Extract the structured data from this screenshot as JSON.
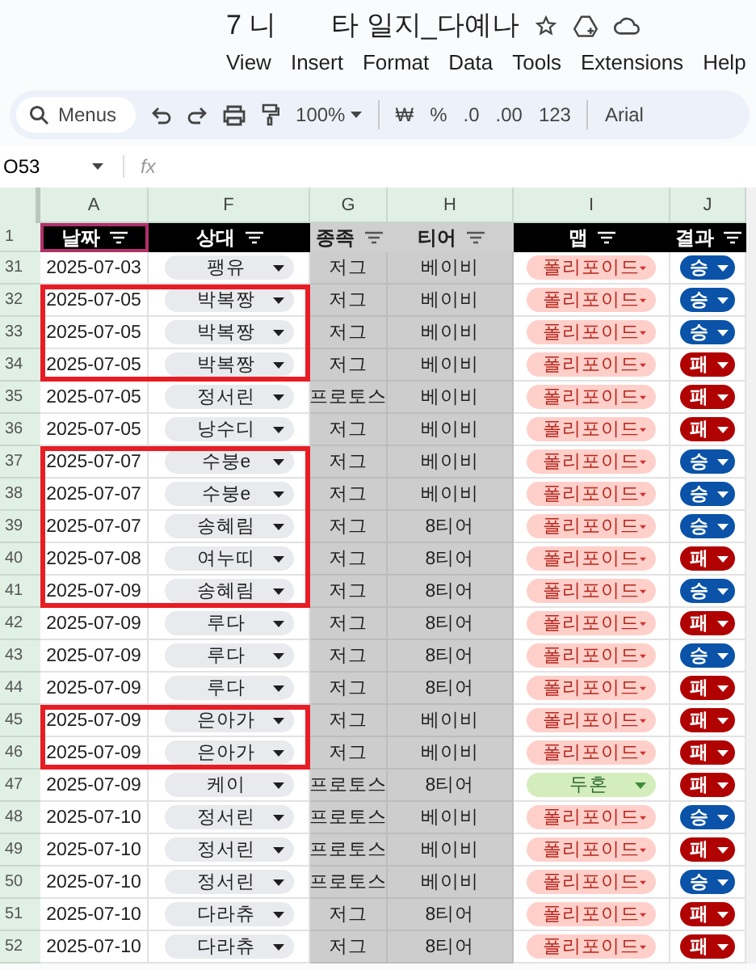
{
  "window": {
    "title_start": "7 니",
    "title_end": "타 일지_다예나"
  },
  "menu": [
    "View",
    "Insert",
    "Format",
    "Data",
    "Tools",
    "Extensions",
    "Help"
  ],
  "toolbar": {
    "search_label": "Menus",
    "zoom": "100%",
    "currency": "₩",
    "percent": "%",
    "decrease_decimal": ".0",
    "increase_decimal": ".00",
    "number_format": "123",
    "font": "Arial"
  },
  "name_box": "O53",
  "formula_label": "fx",
  "sheet": {
    "columns": [
      "A",
      "F",
      "G",
      "H",
      "I",
      "J"
    ],
    "header_row": "1",
    "headers": [
      {
        "label": "날짜",
        "kind": "dark",
        "selected": true
      },
      {
        "label": "상대",
        "kind": "dark",
        "selected": false
      },
      {
        "label": "종족",
        "kind": "shaded",
        "selected": false
      },
      {
        "label": "티어",
        "kind": "shaded",
        "selected": false
      },
      {
        "label": "맵",
        "kind": "dark",
        "selected": false
      },
      {
        "label": "결과",
        "kind": "dark",
        "selected": false
      }
    ],
    "row_groups": [
      {
        "outlined": false,
        "rows": [
          {
            "number": "31",
            "date": "2025-07-03",
            "opponent": "팽유",
            "race": "저그",
            "tier": "베이비",
            "map": {
              "label": "폴리포이드",
              "color": "#ffcfc9"
            },
            "result": {
              "label": "승",
              "color": "#0a53a8"
            }
          }
        ]
      },
      {
        "outlined": true,
        "rows": [
          {
            "number": "32",
            "date": "2025-07-05",
            "opponent": "박복짱",
            "race": "저그",
            "tier": "베이비",
            "map": {
              "label": "폴리포이드",
              "color": "#ffcfc9"
            },
            "result": {
              "label": "승",
              "color": "#0a53a8"
            }
          },
          {
            "number": "33",
            "date": "2025-07-05",
            "opponent": "박복짱",
            "race": "저그",
            "tier": "베이비",
            "map": {
              "label": "폴리포이드",
              "color": "#ffcfc9"
            },
            "result": {
              "label": "승",
              "color": "#0a53a8"
            }
          },
          {
            "number": "34",
            "date": "2025-07-05",
            "opponent": "박복짱",
            "race": "저그",
            "tier": "베이비",
            "map": {
              "label": "폴리포이드",
              "color": "#ffcfc9"
            },
            "result": {
              "label": "패",
              "color": "#b10202"
            }
          }
        ]
      },
      {
        "outlined": false,
        "rows": [
          {
            "number": "35",
            "date": "2025-07-05",
            "opponent": "정서린",
            "race": "프로토스",
            "tier": "베이비",
            "map": {
              "label": "폴리포이드",
              "color": "#ffcfc9"
            },
            "result": {
              "label": "패",
              "color": "#b10202"
            }
          },
          {
            "number": "36",
            "date": "2025-07-05",
            "opponent": "낭수디",
            "race": "저그",
            "tier": "베이비",
            "map": {
              "label": "폴리포이드",
              "color": "#ffcfc9"
            },
            "result": {
              "label": "패",
              "color": "#b10202"
            }
          }
        ]
      },
      {
        "outlined": true,
        "rows": [
          {
            "number": "37",
            "date": "2025-07-07",
            "opponent": "수붕e",
            "race": "저그",
            "tier": "베이비",
            "map": {
              "label": "폴리포이드",
              "color": "#ffcfc9"
            },
            "result": {
              "label": "승",
              "color": "#0a53a8"
            }
          },
          {
            "number": "38",
            "date": "2025-07-07",
            "opponent": "수붕e",
            "race": "저그",
            "tier": "베이비",
            "map": {
              "label": "폴리포이드",
              "color": "#ffcfc9"
            },
            "result": {
              "label": "승",
              "color": "#0a53a8"
            }
          },
          {
            "number": "39",
            "date": "2025-07-07",
            "opponent": "송혜림",
            "race": "저그",
            "tier": "8티어",
            "map": {
              "label": "폴리포이드",
              "color": "#ffcfc9"
            },
            "result": {
              "label": "승",
              "color": "#0a53a8"
            }
          },
          {
            "number": "40",
            "date": "2025-07-08",
            "opponent": "여누띠",
            "race": "저그",
            "tier": "8티어",
            "map": {
              "label": "폴리포이드",
              "color": "#ffcfc9"
            },
            "result": {
              "label": "패",
              "color": "#b10202"
            }
          },
          {
            "number": "41",
            "date": "2025-07-09",
            "opponent": "송혜림",
            "race": "저그",
            "tier": "8티어",
            "map": {
              "label": "폴리포이드",
              "color": "#ffcfc9"
            },
            "result": {
              "label": "승",
              "color": "#0a53a8"
            }
          }
        ]
      },
      {
        "outlined": false,
        "rows": [
          {
            "number": "42",
            "date": "2025-07-09",
            "opponent": "루다",
            "race": "저그",
            "tier": "8티어",
            "map": {
              "label": "폴리포이드",
              "color": "#ffcfc9"
            },
            "result": {
              "label": "패",
              "color": "#b10202"
            }
          },
          {
            "number": "43",
            "date": "2025-07-09",
            "opponent": "루다",
            "race": "저그",
            "tier": "8티어",
            "map": {
              "label": "폴리포이드",
              "color": "#ffcfc9"
            },
            "result": {
              "label": "승",
              "color": "#0a53a8"
            }
          },
          {
            "number": "44",
            "date": "2025-07-09",
            "opponent": "루다",
            "race": "저그",
            "tier": "8티어",
            "map": {
              "label": "폴리포이드",
              "color": "#ffcfc9"
            },
            "result": {
              "label": "패",
              "color": "#b10202"
            }
          }
        ]
      },
      {
        "outlined": true,
        "rows": [
          {
            "number": "45",
            "date": "2025-07-09",
            "opponent": "은아가",
            "race": "저그",
            "tier": "베이비",
            "map": {
              "label": "폴리포이드",
              "color": "#ffcfc9"
            },
            "result": {
              "label": "패",
              "color": "#b10202"
            }
          },
          {
            "number": "46",
            "date": "2025-07-09",
            "opponent": "은아가",
            "race": "저그",
            "tier": "베이비",
            "map": {
              "label": "폴리포이드",
              "color": "#ffcfc9"
            },
            "result": {
              "label": "패",
              "color": "#b10202"
            }
          }
        ]
      },
      {
        "outlined": false,
        "rows": [
          {
            "number": "47",
            "date": "2025-07-09",
            "opponent": "케이",
            "race": "프로토스",
            "tier": "8티어",
            "map": {
              "label": "두혼",
              "color": "#d4edbc"
            },
            "result": {
              "label": "패",
              "color": "#b10202"
            }
          },
          {
            "number": "48",
            "date": "2025-07-10",
            "opponent": "정서린",
            "race": "프로토스",
            "tier": "베이비",
            "map": {
              "label": "폴리포이드",
              "color": "#ffcfc9"
            },
            "result": {
              "label": "승",
              "color": "#0a53a8"
            }
          },
          {
            "number": "49",
            "date": "2025-07-10",
            "opponent": "정서린",
            "race": "프로토스",
            "tier": "베이비",
            "map": {
              "label": "폴리포이드",
              "color": "#ffcfc9"
            },
            "result": {
              "label": "패",
              "color": "#b10202"
            }
          },
          {
            "number": "50",
            "date": "2025-07-10",
            "opponent": "정서린",
            "race": "프로토스",
            "tier": "베이비",
            "map": {
              "label": "폴리포이드",
              "color": "#ffcfc9"
            },
            "result": {
              "label": "승",
              "color": "#0a53a8"
            }
          },
          {
            "number": "51",
            "date": "2025-07-10",
            "opponent": "다라츄",
            "race": "저그",
            "tier": "8티어",
            "map": {
              "label": "폴리포이드",
              "color": "#ffcfc9"
            },
            "result": {
              "label": "패",
              "color": "#b10202"
            }
          },
          {
            "number": "52",
            "date": "2025-07-10",
            "opponent": "다라츄",
            "race": "저그",
            "tier": "8티어",
            "map": {
              "label": "폴리포이드",
              "color": "#ffcfc9"
            },
            "result": {
              "label": "패",
              "color": "#b10202"
            }
          }
        ]
      }
    ]
  }
}
